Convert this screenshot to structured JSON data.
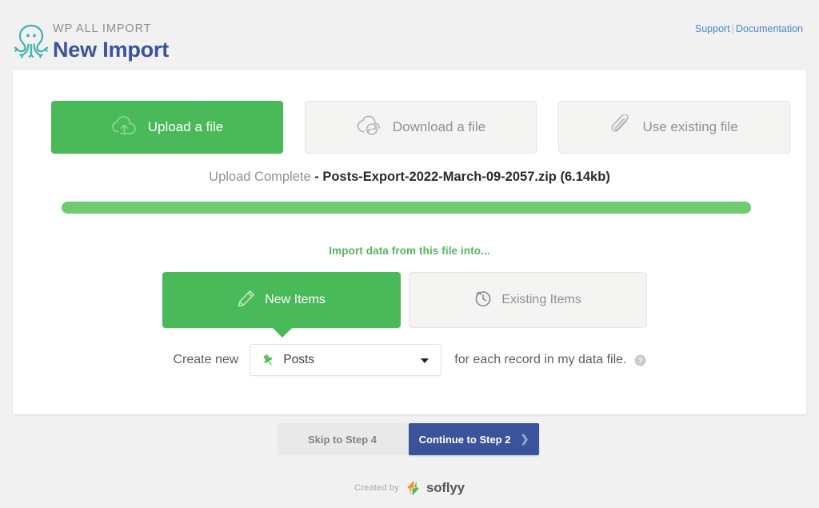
{
  "header": {
    "logo_icon": "octopus-icon",
    "brand_small": "WP ALL IMPORT",
    "brand_title": "New Import",
    "support_link": "Support",
    "link_separator": "|",
    "documentation_link": "Documentation",
    "link_color": "#4a88c7",
    "brand_color": "#3a539b"
  },
  "source_tabs": [
    {
      "id": "upload",
      "label": "Upload a file",
      "icon": "cloud-upload-icon",
      "active": true
    },
    {
      "id": "download",
      "label": "Download a file",
      "icon": "cloud-download-icon",
      "active": false
    },
    {
      "id": "existing",
      "label": "Use existing file",
      "icon": "paperclip-icon",
      "active": false
    }
  ],
  "upload": {
    "status_lead": "Upload Complete",
    "filename": "- Posts-Export-2022-March-09-2057.zip (6.14kb)",
    "progress_percent": 100,
    "progress_color": "#70ca6e"
  },
  "import_into": {
    "heading": "Import data from this file into...",
    "heading_color": "#56b65f",
    "mode_tabs": [
      {
        "id": "new",
        "label": "New Items",
        "icon": "pencil-icon",
        "active": true
      },
      {
        "id": "existing",
        "label": "Existing Items",
        "icon": "clock-history-icon",
        "active": false
      }
    ]
  },
  "create_row": {
    "prefix_label": "Create new",
    "select_icon": "pushpin-icon",
    "select_value": "Posts",
    "select_options": [
      "Posts"
    ],
    "suffix_label": "for each record in my data file.",
    "help_icon": "help-circle-icon"
  },
  "footer_buttons": {
    "skip_label": "Skip to Step 4",
    "continue_label": "Continue to Step 2",
    "continue_icon": "chevron-right-icon",
    "continue_color": "#3a539b"
  },
  "created_by": {
    "text": "Created by",
    "logo_icon": "soflyy-logo-icon",
    "name": "soflyy"
  }
}
